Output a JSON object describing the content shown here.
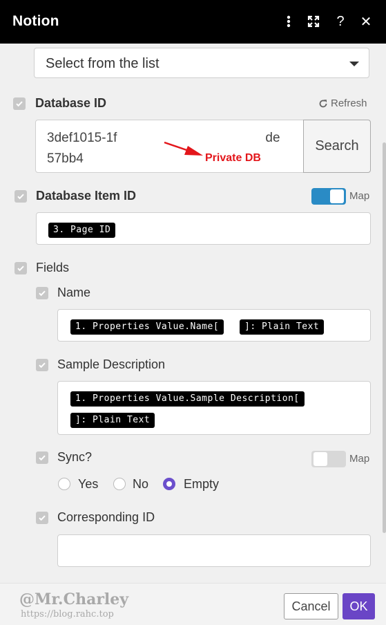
{
  "header": {
    "title": "Notion",
    "menu_icon": "more-vertical-icon",
    "expand_icon": "expand-icon",
    "help_label": "?",
    "close_label": "✕"
  },
  "select": {
    "value": "Select from the list"
  },
  "database_id": {
    "label": "Database ID",
    "refresh_label": "Refresh",
    "value_line1": "3def1015-1f",
    "value_line1_end": "de",
    "value_line2": "57bb4",
    "search_label": "Search",
    "annotation": "Private DB"
  },
  "database_item_id": {
    "label": "Database Item ID",
    "map_label": "Map",
    "map_on": true,
    "pill": "3. Page ID"
  },
  "fields": {
    "label": "Fields",
    "name": {
      "label": "Name",
      "pill1": "1. Properties Value.Name[",
      "pill2": "]: Plain Text"
    },
    "sample_description": {
      "label": "Sample Description",
      "pill1": "1. Properties Value.Sample Description[",
      "pill2": "]: Plain Text"
    },
    "sync": {
      "label": "Sync?",
      "map_label": "Map",
      "map_on": false,
      "options": [
        "Yes",
        "No",
        "Empty"
      ],
      "selected": "Empty"
    },
    "corresponding_id": {
      "label": "Corresponding ID",
      "value": ""
    }
  },
  "footer": {
    "watermark": "@Mr.Charley",
    "watermark_url": "https://blog.rahc.top",
    "cancel_label": "Cancel",
    "ok_label": "OK"
  },
  "colors": {
    "accent": "#6a45c6",
    "toggle_on": "#2a8bc5",
    "annotation": "#e3161b"
  }
}
